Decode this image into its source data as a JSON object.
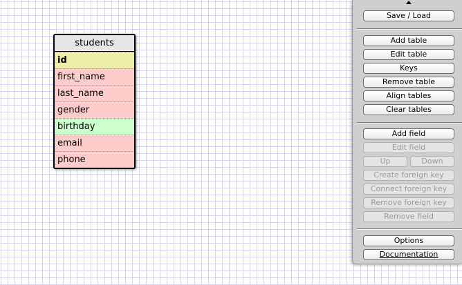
{
  "table": {
    "name": "students",
    "fields": [
      {
        "name": "id"
      },
      {
        "name": "first_name"
      },
      {
        "name": "last_name"
      },
      {
        "name": "gender"
      },
      {
        "name": "birthday"
      },
      {
        "name": "email"
      },
      {
        "name": "phone"
      }
    ]
  },
  "panel": {
    "save_load": "Save / Load",
    "add_table": "Add table",
    "edit_table": "Edit table",
    "keys": "Keys",
    "remove_table": "Remove table",
    "align_tables": "Align tables",
    "clear_tables": "Clear tables",
    "add_field": "Add field",
    "edit_field": "Edit field",
    "up": "Up",
    "down": "Down",
    "create_foreign_key": "Create foreign key",
    "connect_foreign_key": "Connect foreign key",
    "remove_foreign_key": "Remove foreign key",
    "remove_field": "Remove field",
    "options": "Options",
    "documentation": "Documentation"
  },
  "colors": {
    "grid_line": "#d4d4ee",
    "primary_key_row": "#eeeeaa",
    "field_row": "#ffcccc",
    "highlighted_row": "#ccffcc",
    "panel_bg": "#cfcfcf"
  },
  "icons": {
    "panel_toggle": "triangle-up-icon"
  }
}
